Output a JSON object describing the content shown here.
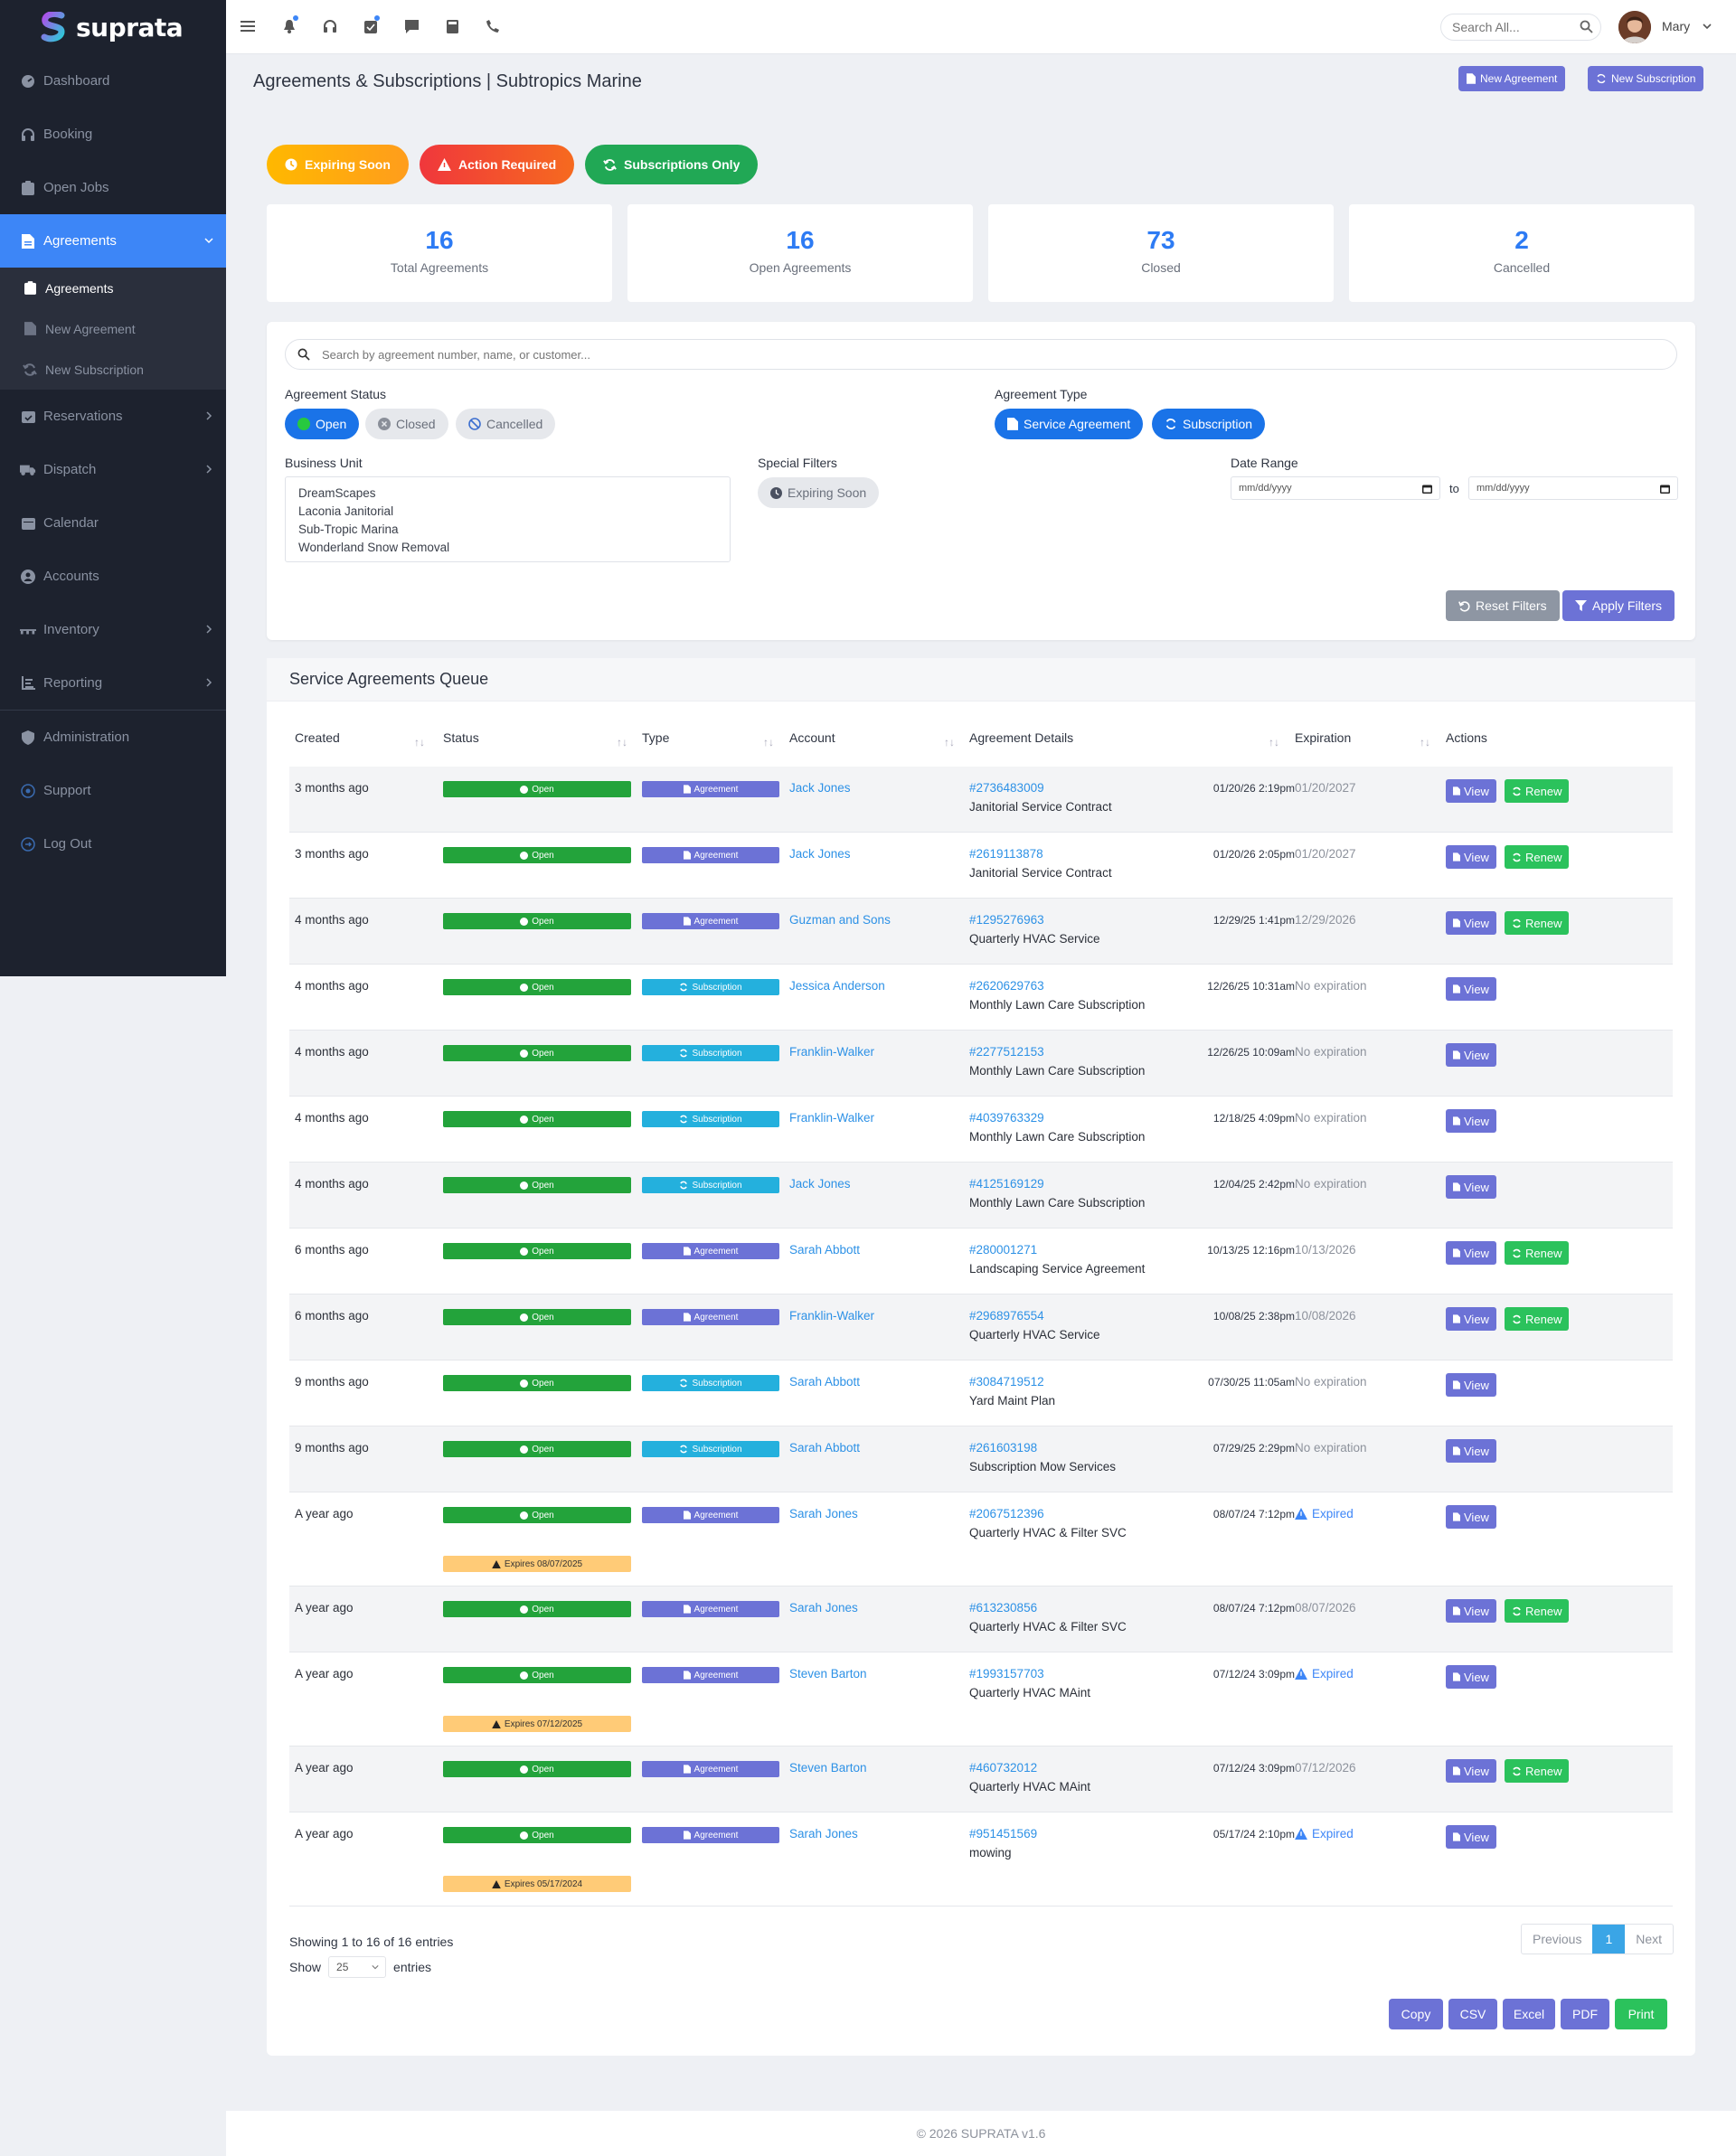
{
  "app": {
    "brand": "suprata"
  },
  "sidebar": {
    "items": [
      {
        "label": "Dashboard",
        "icon": "dashboard-icon"
      },
      {
        "label": "Booking",
        "icon": "headset-icon"
      },
      {
        "label": "Open Jobs",
        "icon": "clipboard-icon"
      },
      {
        "label": "Agreements",
        "icon": "document-icon"
      },
      {
        "label": "Reservations",
        "icon": "calendar-check-icon"
      },
      {
        "label": "Dispatch",
        "icon": "truck-icon"
      },
      {
        "label": "Calendar",
        "icon": "calendar-icon"
      },
      {
        "label": "Accounts",
        "icon": "user-circle-icon"
      },
      {
        "label": "Inventory",
        "icon": "warehouse-icon"
      },
      {
        "label": "Reporting",
        "icon": "chart-icon"
      },
      {
        "label": "Administration",
        "icon": "shield-icon"
      },
      {
        "label": "Support",
        "icon": "support-icon"
      },
      {
        "label": "Log Out",
        "icon": "logout-icon"
      }
    ],
    "sub": [
      {
        "label": "Agreements"
      },
      {
        "label": "New Agreement"
      },
      {
        "label": "New Subscription"
      }
    ]
  },
  "topbar": {
    "search_placeholder": "Search All...",
    "user": "Mary"
  },
  "header": {
    "title": "Agreements & Subscriptions | Subtropics Marine",
    "new_agreement": "New Agreement",
    "new_subscription": "New Subscription"
  },
  "pills": {
    "expiring": "Expiring Soon",
    "action": "Action Required",
    "subs": "Subscriptions Only"
  },
  "stats": [
    {
      "value": "16",
      "label": "Total Agreements"
    },
    {
      "value": "16",
      "label": "Open Agreements"
    },
    {
      "value": "73",
      "label": "Closed"
    },
    {
      "value": "2",
      "label": "Cancelled"
    }
  ],
  "filters": {
    "search_placeholder": "Search by agreement number, name, or customer...",
    "status_label": "Agreement Status",
    "status_open": "Open",
    "status_closed": "Closed",
    "status_cancelled": "Cancelled",
    "type_label": "Agreement Type",
    "type_service": "Service Agreement",
    "type_subscription": "Subscription",
    "bu_label": "Business Unit",
    "business_units": [
      "DreamScapes",
      "Laconia Janitorial",
      "Sub-Tropic Marina",
      "Wonderland Snow Removal"
    ],
    "special_label": "Special Filters",
    "special_expiring": "Expiring Soon",
    "date_label": "Date Range",
    "date_placeholder": "mm/dd/yyyy",
    "date_to": "to",
    "reset": "Reset Filters",
    "apply": "Apply Filters"
  },
  "queue": {
    "title": "Service Agreements Queue",
    "columns": [
      "Created",
      "Status",
      "Type",
      "Account",
      "Agreement Details",
      "Expiration",
      "Actions"
    ],
    "view_label": "View",
    "renew_label": "Renew",
    "rows": [
      {
        "created": "3 months ago",
        "status": "Open",
        "type": "Agreement",
        "account": "Jack Jones",
        "number": "#2736483009",
        "name": "Janitorial Service Contract",
        "date": "01/20/26 2:19pm",
        "expiration": "01/20/2027",
        "renew": true
      },
      {
        "created": "3 months ago",
        "status": "Open",
        "type": "Agreement",
        "account": "Jack Jones",
        "number": "#2619113878",
        "name": "Janitorial Service Contract",
        "date": "01/20/26 2:05pm",
        "expiration": "01/20/2027",
        "renew": true
      },
      {
        "created": "4 months ago",
        "status": "Open",
        "type": "Agreement",
        "account": "Guzman and Sons",
        "number": "#1295276963",
        "name": "Quarterly HVAC Service",
        "date": "12/29/25 1:41pm",
        "expiration": "12/29/2026",
        "renew": true
      },
      {
        "created": "4 months ago",
        "status": "Open",
        "type": "Subscription",
        "account": "Jessica Anderson",
        "number": "#2620629763",
        "name": "Monthly Lawn Care Subscription",
        "date": "12/26/25 10:31am",
        "expiration": "No expiration",
        "renew": false
      },
      {
        "created": "4 months ago",
        "status": "Open",
        "type": "Subscription",
        "account": "Franklin-Walker",
        "number": "#2277512153",
        "name": "Monthly Lawn Care Subscription",
        "date": "12/26/25 10:09am",
        "expiration": "No expiration",
        "renew": false
      },
      {
        "created": "4 months ago",
        "status": "Open",
        "type": "Subscription",
        "account": "Franklin-Walker",
        "number": "#4039763329",
        "name": "Monthly Lawn Care Subscription",
        "date": "12/18/25 4:09pm",
        "expiration": "No expiration",
        "renew": false
      },
      {
        "created": "4 months ago",
        "status": "Open",
        "type": "Subscription",
        "account": "Jack Jones",
        "number": "#4125169129",
        "name": "Monthly Lawn Care Subscription",
        "date": "12/04/25 2:42pm",
        "expiration": "No expiration",
        "renew": false
      },
      {
        "created": "6 months ago",
        "status": "Open",
        "type": "Agreement",
        "account": "Sarah Abbott",
        "number": "#280001271",
        "name": "Landscaping Service Agreement",
        "date": "10/13/25 12:16pm",
        "expiration": "10/13/2026",
        "renew": true
      },
      {
        "created": "6 months ago",
        "status": "Open",
        "type": "Agreement",
        "account": "Franklin-Walker",
        "number": "#2968976554",
        "name": "Quarterly HVAC Service",
        "date": "10/08/25 2:38pm",
        "expiration": "10/08/2026",
        "renew": true
      },
      {
        "created": "9 months ago",
        "status": "Open",
        "type": "Subscription",
        "account": "Sarah Abbott",
        "number": "#3084719512",
        "name": "Yard Maint Plan",
        "date": "07/30/25 11:05am",
        "expiration": "No expiration",
        "renew": false
      },
      {
        "created": "9 months ago",
        "status": "Open",
        "type": "Subscription",
        "account": "Sarah Abbott",
        "number": "#261603198",
        "name": "Subscription Mow Services",
        "date": "07/29/25 2:29pm",
        "expiration": "No expiration",
        "renew": false
      },
      {
        "created": "A year ago",
        "status": "Open",
        "type": "Agreement",
        "account": "Sarah Jones",
        "number": "#2067512396",
        "name": "Quarterly HVAC & Filter SVC",
        "date": "08/07/24 7:12pm",
        "expiration": "Expired",
        "expired": true,
        "expires_badge": "Expires 08/07/2025",
        "renew": false
      },
      {
        "created": "A year ago",
        "status": "Open",
        "type": "Agreement",
        "account": "Sarah Jones",
        "number": "#613230856",
        "name": "Quarterly HVAC & Filter SVC",
        "date": "08/07/24 7:12pm",
        "expiration": "08/07/2026",
        "renew": true
      },
      {
        "created": "A year ago",
        "status": "Open",
        "type": "Agreement",
        "account": "Steven Barton",
        "number": "#1993157703",
        "name": "Quarterly HVAC MAint",
        "date": "07/12/24 3:09pm",
        "expiration": "Expired",
        "expired": true,
        "expires_badge": "Expires 07/12/2025",
        "renew": false
      },
      {
        "created": "A year ago",
        "status": "Open",
        "type": "Agreement",
        "account": "Steven Barton",
        "number": "#460732012",
        "name": "Quarterly HVAC MAint",
        "date": "07/12/24 3:09pm",
        "expiration": "07/12/2026",
        "renew": true
      },
      {
        "created": "A year ago",
        "status": "Open",
        "type": "Agreement",
        "account": "Sarah Jones",
        "number": "#951451569",
        "name": "mowing",
        "date": "05/17/24 2:10pm",
        "expiration": "Expired",
        "expired": true,
        "expires_badge": "Expires 05/17/2024",
        "renew": false
      }
    ],
    "showing": "Showing 1 to 16 of 16 entries",
    "show": "Show",
    "show_value": "25",
    "entries": "entries",
    "pager": {
      "prev": "Previous",
      "page": "1",
      "next": "Next"
    },
    "export": [
      "Copy",
      "CSV",
      "Excel",
      "PDF",
      "Print"
    ]
  },
  "footer": {
    "text": "© 2026 SUPRATA v1.6"
  },
  "colors": {
    "primary": "#3d86f7",
    "agreement": "#6c72d6",
    "subscription": "#24b0dd",
    "open": "#23a33b",
    "renew": "#2bc25c"
  }
}
